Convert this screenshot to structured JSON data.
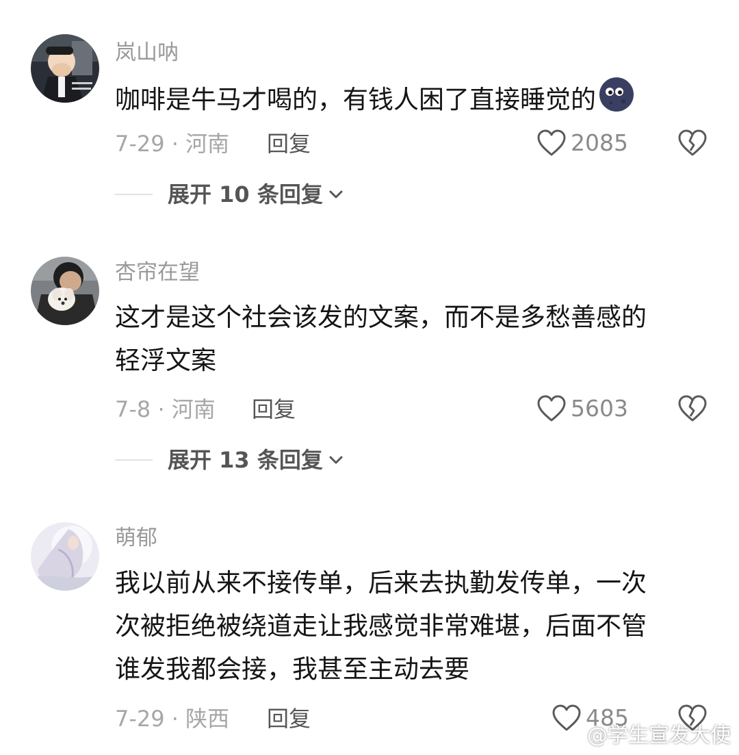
{
  "comments": [
    {
      "username": "岚山呐",
      "text": "咖啡是牛马才喝的，有钱人困了直接睡觉的",
      "emoji": "new-moon-face-emoji",
      "date_location": "7-29 · 河南",
      "reply_label": "回复",
      "likes": "2085",
      "expand_label": "展开 10 条回复"
    },
    {
      "username": "杏帘在望",
      "text_lines": [
        "这才是这个社会该发的文案，而不是多愁善感的",
        "轻浮文案"
      ],
      "date_location": "7-8 · 河南",
      "reply_label": "回复",
      "likes": "5603",
      "expand_label": "展开 13 条回复"
    },
    {
      "username": "萌郁",
      "text_lines": [
        "我以前从来不接传单，后来去执勤发传单，一次",
        "次被拒绝被绕道走让我感觉非常难堪，后面不管",
        "谁发我都会接，我甚至主动去要"
      ],
      "date_location": "7-29 · 陕西",
      "reply_label": "回复",
      "likes": "485"
    }
  ],
  "watermark": "@学生宣发大使",
  "icons": {
    "like": "heart-outline-icon",
    "dislike": "broken-heart-icon",
    "expand": "chevron-down-icon",
    "watermark": "weibo-logo-icon"
  },
  "colors": {
    "text": "#151515",
    "muted": "#9a9a9a",
    "action": "#555555"
  }
}
